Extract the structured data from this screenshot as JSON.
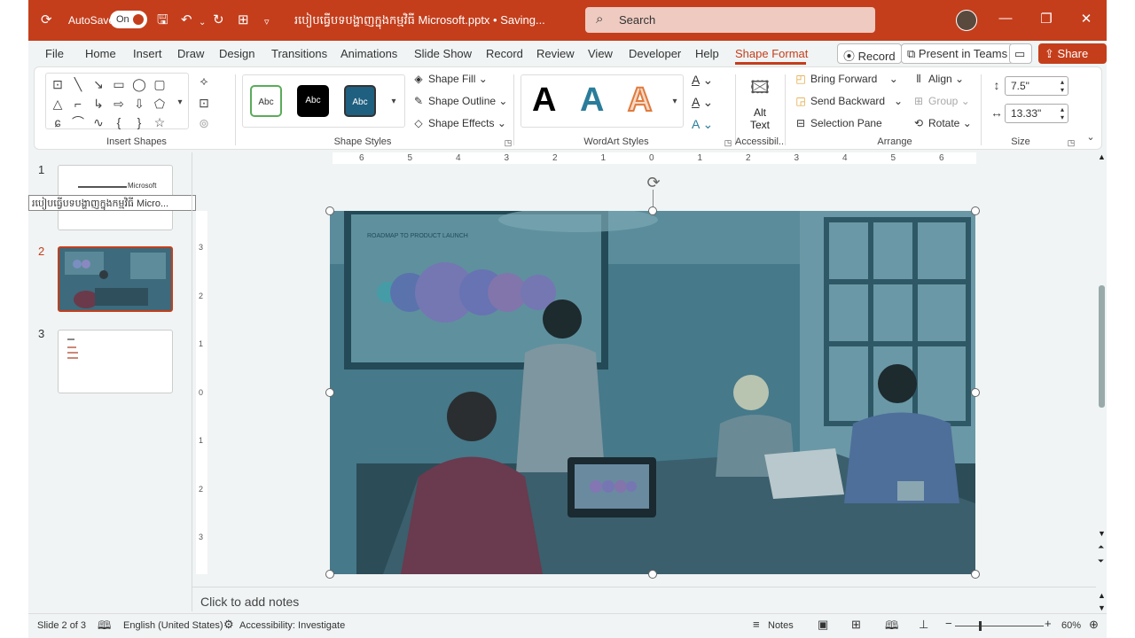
{
  "titlebar": {
    "autosave_label": "AutoSave",
    "autosave_state": "On",
    "doc_title": "របៀបធ្វើបទបង្ហាញក្នុងកម្មវិធី Microsoft.pptx • Saving...",
    "search_placeholder": "Search"
  },
  "tabs": [
    "File",
    "Home",
    "Insert",
    "Draw",
    "Design",
    "Transitions",
    "Animations",
    "Slide Show",
    "Record",
    "Review",
    "View",
    "Developer",
    "Help",
    "Shape Format"
  ],
  "tab_buttons": {
    "record": "Record",
    "present": "Present in Teams",
    "share": "Share"
  },
  "ribbon": {
    "groups": {
      "insert_shapes": "Insert Shapes",
      "shape_styles": "Shape Styles",
      "wordart_styles": "WordArt Styles",
      "accessibility": "Accessibil...",
      "arrange": "Arrange",
      "size": "Size"
    },
    "style_samples": [
      "Abc",
      "Abc",
      "Abc"
    ],
    "shape_fill": "Shape Fill",
    "shape_outline": "Shape Outline",
    "shape_effects": "Shape Effects",
    "wordart_letter": "A",
    "alt_text": "Alt Text",
    "bring_forward": "Bring Forward",
    "send_backward": "Send Backward",
    "selection_pane": "Selection Pane",
    "align": "Align",
    "group": "Group",
    "rotate": "Rotate",
    "height": "7.5\"",
    "width": "13.33\""
  },
  "slides": {
    "numbers": [
      "1",
      "2",
      "3"
    ],
    "thumb1_text": "Microsoft",
    "tooltip": "របៀបធ្វើបទបង្ហាញក្នុងកម្មវិធី Micro..."
  },
  "slide": {
    "poster_title": "ROADMAP TO PRODUCT LAUNCH"
  },
  "rulers": {
    "h_ticks": [
      "6",
      "5",
      "4",
      "3",
      "2",
      "1",
      "0",
      "1",
      "2",
      "3",
      "4",
      "5",
      "6"
    ],
    "v_ticks": [
      "3",
      "2",
      "1",
      "0",
      "1",
      "2",
      "3"
    ]
  },
  "notes_placeholder": "Click to add notes",
  "status": {
    "slide": "Slide 2 of 3",
    "language": "English (United States)",
    "accessibility": "Accessibility: Investigate",
    "notes": "Notes",
    "zoom": "60%"
  }
}
